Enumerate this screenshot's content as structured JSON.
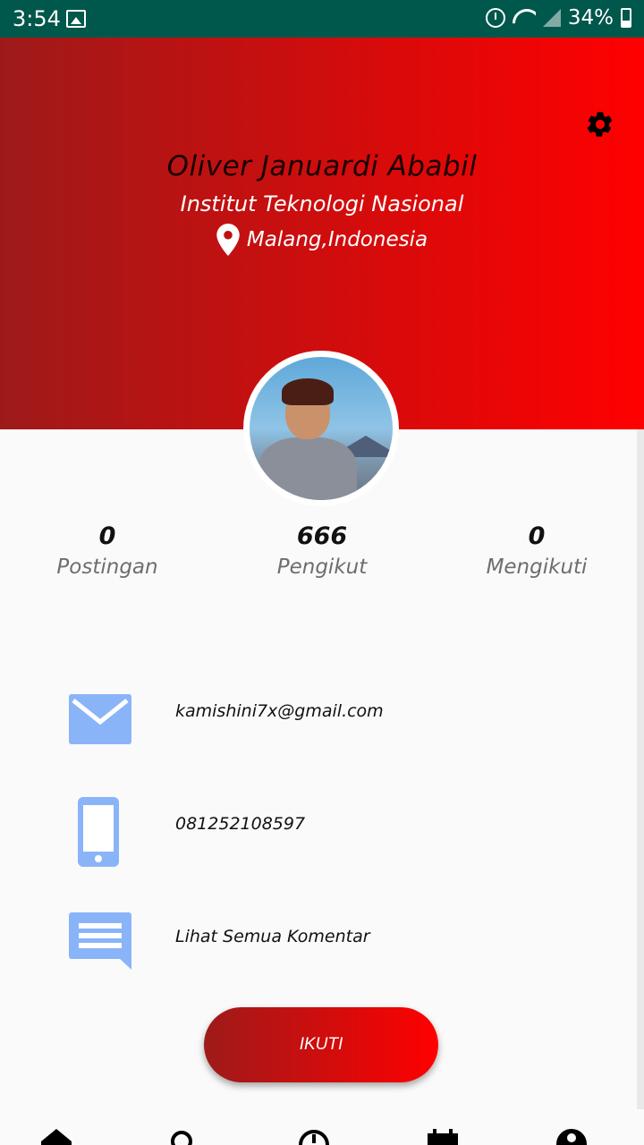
{
  "status_bar": {
    "time": "3:54",
    "battery": "34%",
    "icons": [
      "gallery-icon",
      "alarm-icon",
      "wifi-icon",
      "signal-icon",
      "battery-icon"
    ]
  },
  "profile": {
    "name": "Oliver Januardi Ababil",
    "institution": "Institut Teknologi Nasional",
    "location": "Malang,Indonesia"
  },
  "stats": [
    {
      "value": "0",
      "label": "Postingan"
    },
    {
      "value": "666",
      "label": "Pengikut"
    },
    {
      "value": "0",
      "label": "Mengikuti"
    }
  ],
  "contact": {
    "email": "kamishini7x@gmail.com",
    "phone": "081252108597",
    "comments": "Lihat Semua Komentar"
  },
  "follow_button": "IKUTI",
  "bottom_nav": [
    "home-icon",
    "search-icon",
    "clock-icon",
    "calendar-icon",
    "profile-icon"
  ],
  "colors": {
    "header_start": "#9e1a1a",
    "header_end": "#ff0000",
    "status_bar": "#00574b",
    "icon_blue": "#8ab4f8"
  }
}
